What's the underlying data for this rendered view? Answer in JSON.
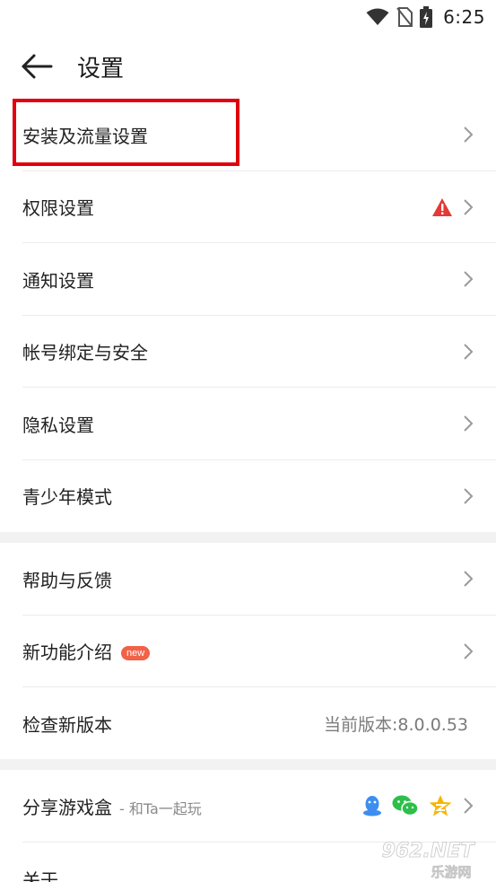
{
  "status_bar": {
    "time": "6:25"
  },
  "header": {
    "title": "设置"
  },
  "section1": {
    "items": [
      {
        "label": "安装及流量设置"
      },
      {
        "label": "权限设置"
      },
      {
        "label": "通知设置"
      },
      {
        "label": "帐号绑定与安全"
      },
      {
        "label": "隐私设置"
      },
      {
        "label": "青少年模式"
      }
    ]
  },
  "section2": {
    "items": [
      {
        "label": "帮助与反馈"
      },
      {
        "label": "新功能介绍",
        "badge": "new"
      },
      {
        "label": "检查新版本",
        "value": "当前版本:8.0.0.53"
      }
    ]
  },
  "section3": {
    "items": [
      {
        "label": "分享游戏盒",
        "subtitle": "- 和Ta一起玩"
      },
      {
        "label": "关于"
      }
    ]
  },
  "watermark": {
    "brand_top": "962.NET",
    "brand_bottom": "乐游网"
  },
  "colors": {
    "highlight": "#e0000e",
    "warning": "#e53935",
    "badge": "#f26247",
    "section_gap": "#f2f2f2"
  }
}
